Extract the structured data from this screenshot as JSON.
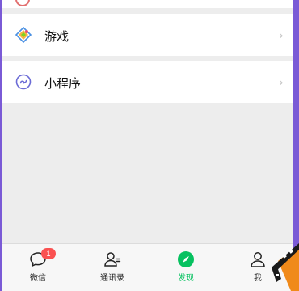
{
  "menu": {
    "items": [
      {
        "label": "游戏",
        "icon": "games-icon"
      },
      {
        "label": "小程序",
        "icon": "mini-programs-icon"
      }
    ],
    "chevron": "›"
  },
  "tabbar": {
    "tabs": [
      {
        "label": "微信",
        "icon": "chat-bubble-icon",
        "badge": "1"
      },
      {
        "label": "通讯录",
        "icon": "contacts-icon"
      },
      {
        "label": "发现",
        "icon": "discover-compass-icon",
        "active": true
      },
      {
        "label": "我",
        "icon": "person-icon"
      }
    ]
  },
  "colors": {
    "accent": "#07c160",
    "badge": "#fa5151",
    "frame": "#7a5ad6",
    "film": "#f08a1a"
  }
}
